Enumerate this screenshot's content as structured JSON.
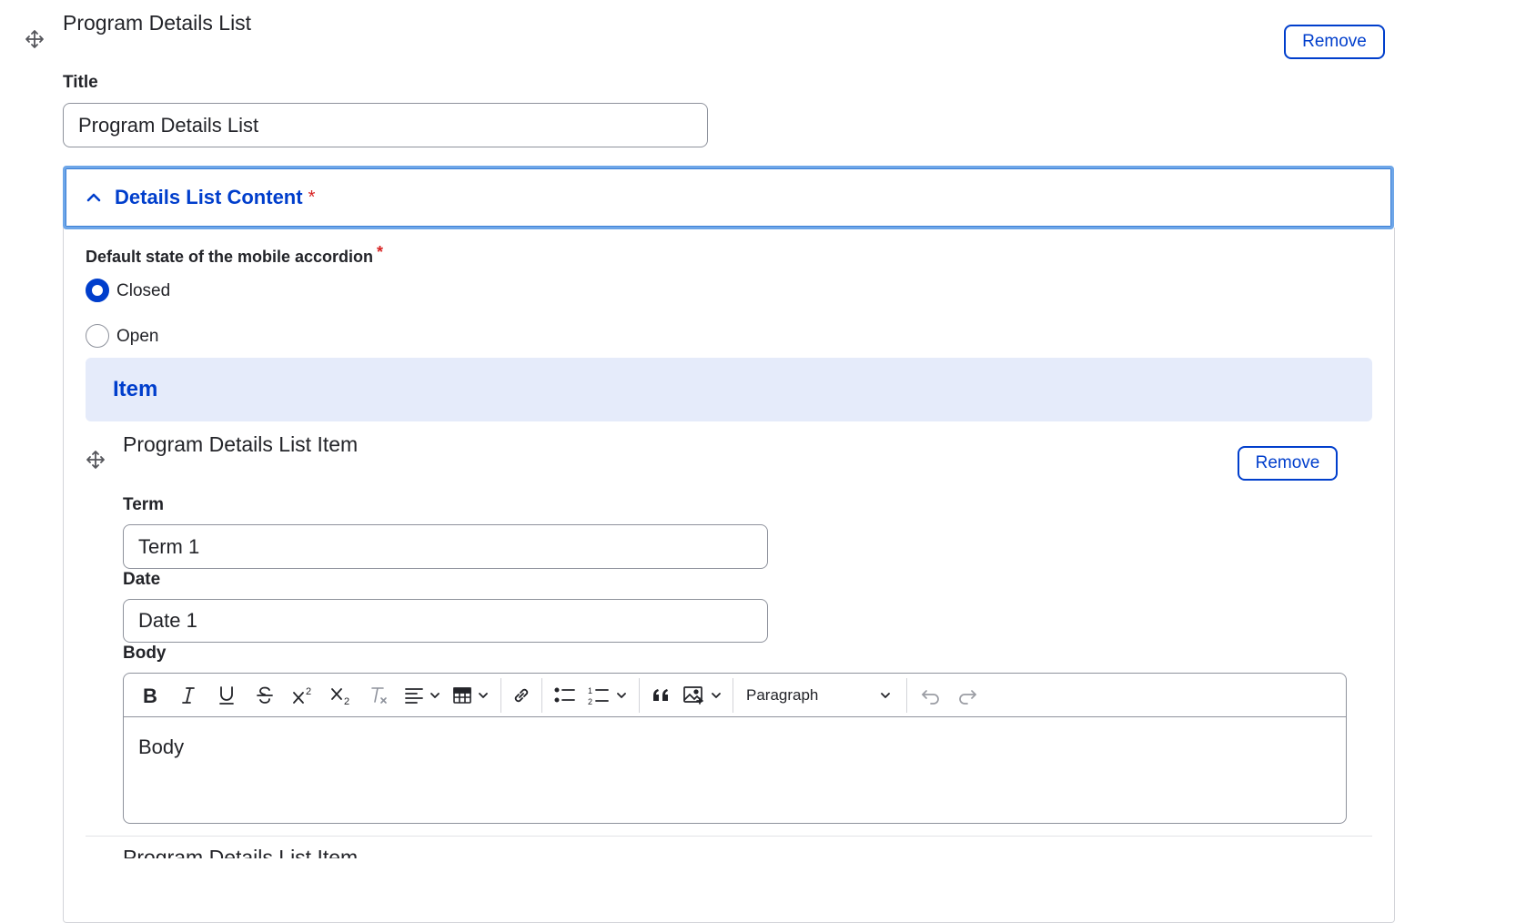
{
  "paragraph": {
    "title": "Program Details List",
    "remove_label": "Remove",
    "title_field": {
      "label": "Title",
      "value": "Program Details List"
    }
  },
  "details": {
    "summary_label": "Details List Content",
    "required_mark": "*",
    "accordion_state": {
      "label": "Default state of the mobile accordion",
      "required_mark": "*",
      "options": [
        {
          "label": "Closed",
          "checked": true
        },
        {
          "label": "Open",
          "checked": false
        }
      ]
    },
    "item_heading": "Item",
    "item": {
      "title": "Program Details List Item",
      "remove_label": "Remove",
      "term": {
        "label": "Term",
        "value": "Term 1"
      },
      "date": {
        "label": "Date",
        "value": "Date 1"
      },
      "body": {
        "label": "Body",
        "content": "Body",
        "heading_select": "Paragraph",
        "toolbar": [
          "bold-icon",
          "italic-icon",
          "underline-icon",
          "strikethrough-icon",
          "superscript-icon",
          "subscript-icon",
          "remove-format-icon",
          "align-icon",
          "table-icon",
          "link-icon",
          "bulleted-list-icon",
          "numbered-list-icon",
          "blockquote-icon",
          "image-icon",
          "undo-icon",
          "redo-icon"
        ]
      }
    },
    "next_item_title": "Program Details List Item"
  },
  "colors": {
    "accent": "#003ecc",
    "focus_ring": "#6ea6e8",
    "item_band": "#e5ebfa",
    "required": "#d72222"
  }
}
